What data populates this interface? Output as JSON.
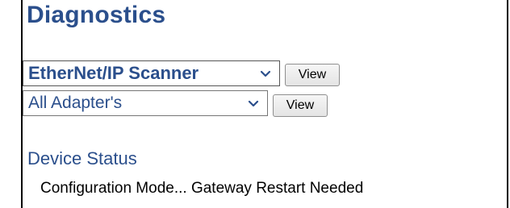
{
  "title": "Diagnostics",
  "scanner_select": {
    "value": "EtherNet/IP Scanner"
  },
  "adapter_select": {
    "value": "All Adapter's"
  },
  "buttons": {
    "view_label": "View"
  },
  "device_status": {
    "heading": "Device Status",
    "message": "Configuration Mode... Gateway Restart Needed"
  },
  "colors": {
    "accent": "#2b4f8c",
    "border": "#000000",
    "button_bg": "#e8e8e8"
  },
  "icons": {
    "dropdown": "chevron-down-icon"
  }
}
